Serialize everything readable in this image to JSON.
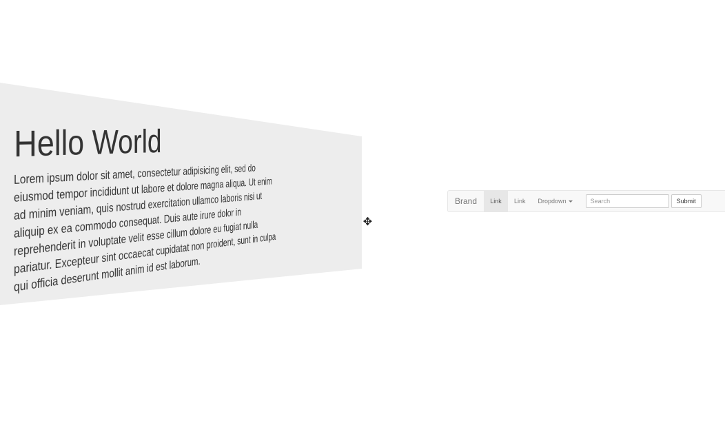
{
  "jumbotron": {
    "title": "Hello World",
    "text": "Lorem ipsum dolor sit amet, consectetur adipisicing elit, sed do eiusmod tempor incididunt ut labore et dolore magna aliqua. Ut enim ad minim veniam, quis nostrud exercitation ullamco laboris nisi ut aliquip ex ea commodo consequat. Duis aute irure dolor in reprehenderit in voluptate velit esse cillum dolore eu fugiat nulla pariatur. Excepteur sint occaecat cupidatat non proident, sunt in culpa qui officia deserunt mollit anim id est laborum."
  },
  "handle": {
    "icon": "move-icon"
  },
  "navbar": {
    "brand": "Brand",
    "links": [
      {
        "label": "Link",
        "active": true
      },
      {
        "label": "Link",
        "active": false
      }
    ],
    "dropdown_label": "Dropdown",
    "search_placeholder": "Search",
    "submit_label": "Submit"
  },
  "colors": {
    "panel_bg": "#ededed",
    "navbar_bg": "#f8f8f8",
    "active_link_bg": "#e7e7e7",
    "text": "#333333"
  }
}
